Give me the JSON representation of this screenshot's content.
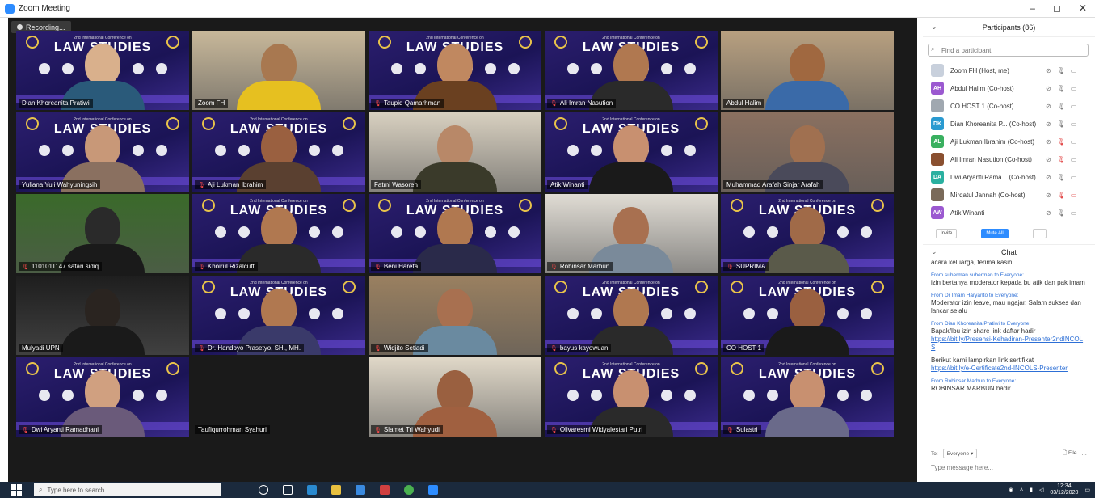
{
  "window": {
    "title": "Zoom Meeting"
  },
  "recording": {
    "label": "Recording..."
  },
  "poster": {
    "title": "LAW STUDIES",
    "subtitle": "2nd International Conference on"
  },
  "tiles": [
    {
      "name": "Dian Khoreanita Pratiwi",
      "kind": "poster",
      "face": "#d9b08c",
      "shirt": "#2a5a7a",
      "mic": false
    },
    {
      "name": "Zoom FH",
      "kind": "room",
      "bg": "#c8b89a",
      "face": "#a87850",
      "shirt": "#e6c020",
      "mic": false
    },
    {
      "name": "Taupiq Qamarhman",
      "kind": "poster",
      "face": "#c08860",
      "shirt": "#6a4020",
      "mic": true
    },
    {
      "name": "Ali Imran Nasution",
      "kind": "poster",
      "face": "#b07850",
      "shirt": "#2a2a2a",
      "mic": true
    },
    {
      "name": "Abdul Halim",
      "kind": "room",
      "bg": "#b8a080",
      "face": "#a06840",
      "shirt": "#3a6aa8",
      "mic": false
    },
    {
      "name": "Yuliana Yuli Wahyuningsih",
      "kind": "poster",
      "face": "#c89878",
      "shirt": "#8a7060",
      "mic": false
    },
    {
      "name": "Aji Lukman Ibrahim",
      "kind": "poster",
      "face": "#9a6040",
      "shirt": "#5a4030",
      "mic": true
    },
    {
      "name": "Fatmi Wasoren",
      "kind": "room",
      "bg": "#d8d0c0",
      "face": "#b88868",
      "shirt": "#3a3a2a",
      "mic": false
    },
    {
      "name": "Atik Winanti",
      "kind": "poster",
      "face": "#c89070",
      "shirt": "#1a1a1a",
      "mic": false
    },
    {
      "name": "Muhammad Arafah Sinjar Arafah",
      "kind": "room",
      "bg": "#8a7060",
      "face": "#a07050",
      "shirt": "#4a4a5a",
      "mic": false
    },
    {
      "name": "1101011147 safari sidiq",
      "kind": "room",
      "bg": "#3a6a2a",
      "face": "#2a2a2a",
      "shirt": "#1a1a1a",
      "mic": true
    },
    {
      "name": "Khoirul Rizalcuff",
      "kind": "poster",
      "face": "#b07850",
      "shirt": "#2a2a2a",
      "mic": true
    },
    {
      "name": "Beni Harefa",
      "kind": "poster",
      "face": "#b07850",
      "shirt": "#2a2a4a",
      "mic": true
    },
    {
      "name": "Robinsar Marbun",
      "kind": "room",
      "bg": "#e0dcd4",
      "face": "#a87050",
      "shirt": "#7a8a9a",
      "mic": true
    },
    {
      "name": "SUPRIMA",
      "kind": "poster",
      "face": "#a06a48",
      "shirt": "#5a5a4a",
      "mic": true
    },
    {
      "name": "Mulyadi UPN",
      "kind": "room",
      "bg": "#1e1e1e",
      "face": "#2a2420",
      "shirt": "#1a1a1a",
      "mic": false
    },
    {
      "name": "Dr. Handoyo Prasetyo, SH., MH.",
      "kind": "poster",
      "face": "#b07850",
      "shirt": "#3a3a6a",
      "mic": true
    },
    {
      "name": "Widjito Setiadi",
      "kind": "room",
      "bg": "#9a8060",
      "face": "#a87050",
      "shirt": "#6a8aa0",
      "mic": true
    },
    {
      "name": "bayus kayowuan",
      "kind": "poster",
      "face": "#b07850",
      "shirt": "#2a2a2a",
      "mic": true
    },
    {
      "name": "CO HOST 1",
      "kind": "poster",
      "face": "#9a6040",
      "shirt": "#1a1a1a",
      "mic": false,
      "active": true
    },
    {
      "name": "Dwi Aryanti Ramadhani",
      "kind": "poster",
      "face": "#d0a080",
      "shirt": "#6a5a7a",
      "mic": true
    },
    {
      "name": "Taufiqurrohman Syahuri",
      "kind": "empty",
      "mic": false
    },
    {
      "name": "Slamet Tri Wahyudi",
      "kind": "room",
      "bg": "#e0d8c8",
      "face": "#9a6040",
      "shirt": "#a06040",
      "mic": true
    },
    {
      "name": "Olivaresmi Widyalestari Putri",
      "kind": "poster",
      "face": "#c89070",
      "shirt": "#2a2a2a",
      "mic": true
    },
    {
      "name": "Sulastri",
      "kind": "poster",
      "face": "#c89070",
      "shirt": "#6a6a8a",
      "mic": true
    }
  ],
  "participants": {
    "header": "Participants (86)",
    "search_placeholder": "Find a participant",
    "list": [
      {
        "initials": "",
        "name": "Zoom FH (Host, me)",
        "color": "#c8d0dc",
        "mic_muted": false,
        "cam_off": false
      },
      {
        "initials": "AH",
        "name": "Abdul Halim (Co-host)",
        "color": "#9b59d0",
        "mic_muted": false,
        "cam_off": false
      },
      {
        "initials": "",
        "name": "CO HOST 1 (Co-host)",
        "color": "#a0a8b0",
        "mic_muted": false,
        "cam_off": false
      },
      {
        "initials": "DK",
        "name": "Dian Khoreanita P... (Co-host)",
        "color": "#2a9ad0",
        "mic_muted": false,
        "cam_off": false
      },
      {
        "initials": "AL",
        "name": "Aji Lukman Ibrahim (Co-host)",
        "color": "#3ab060",
        "mic_muted": true,
        "cam_off": false
      },
      {
        "initials": "",
        "name": "Ali Imran Nasution (Co-host)",
        "color": "#8a5030",
        "mic_muted": true,
        "cam_off": false
      },
      {
        "initials": "DA",
        "name": "Dwi Aryanti Rama... (Co-host)",
        "color": "#2ab0a0",
        "mic_muted": false,
        "cam_off": false
      },
      {
        "initials": "",
        "name": "Mirqatul Jannah (Co-host)",
        "color": "#7a6a5a",
        "mic_muted": true,
        "cam_off": true
      },
      {
        "initials": "AW",
        "name": "Atik Winanti",
        "color": "#9b59d0",
        "mic_muted": false,
        "cam_off": false
      }
    ],
    "invite_label": "Invite",
    "mute_all_label": "Mute All",
    "more_label": "..."
  },
  "chat": {
    "header": "Chat",
    "messages": [
      {
        "from": "",
        "text": "acara keluarga, terima kasih.",
        "links": []
      },
      {
        "from": "From suherman suherman to Everyone:",
        "text": "izin bertanya moderator kepada bu atik dan pak imam",
        "links": []
      },
      {
        "from": "From Dr Imam Haryanto to Everyone:",
        "text": "Moderator izin leave, mau ngajar. Salam sukses dan lancar selalu",
        "links": []
      },
      {
        "from": "From Dian Khoreanita Pratiwi to Everyone:",
        "text": "Bapak/Ibu izin share link daftar hadir",
        "links": [
          "https://bit.ly/Presensi-Kehadiran-Presenter2ndINCOLS"
        ]
      },
      {
        "from": "",
        "text": "Berikut kami lampirkan link sertifikat",
        "links": [
          "https://bit.ly/e-Certificate2nd-INCOLS-Presenter"
        ]
      },
      {
        "from": "From Robinsar Marbun to Everyone:",
        "text": "ROBINSAR MARBUN hadir",
        "links": []
      }
    ],
    "to_label": "To:",
    "to_value": "Everyone",
    "file_label": "File",
    "input_placeholder": "Type message here..."
  },
  "taskbar": {
    "search_placeholder": "Type here to search",
    "time": "12:34",
    "date": "03/12/2020"
  }
}
